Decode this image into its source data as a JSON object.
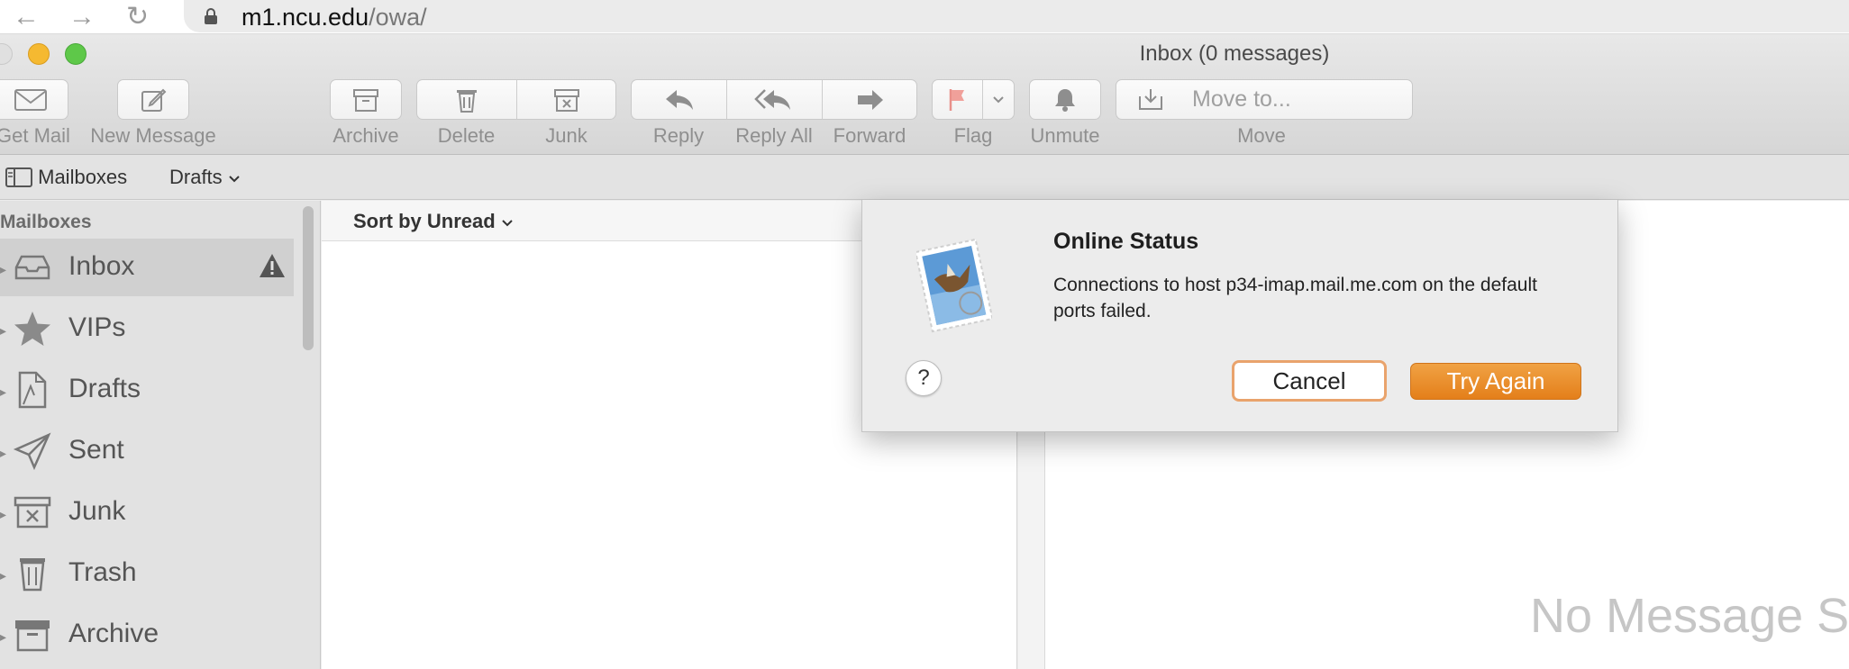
{
  "browser": {
    "url_host": "m1.ncu.edu",
    "url_path": "/owa/",
    "nav": [
      "back-icon",
      "forward-icon",
      "reload-icon"
    ]
  },
  "window": {
    "title": "Inbox (0 messages)",
    "traffic_colors": [
      "#e0e0e0",
      "#f5b931",
      "#5ec849"
    ]
  },
  "toolbar": {
    "get_mail": "Get Mail",
    "new_message": "New Message",
    "archive": "Archive",
    "delete": "Delete",
    "junk": "Junk",
    "reply": "Reply",
    "reply_all": "Reply All",
    "forward": "Forward",
    "flag": "Flag",
    "unmute": "Unmute",
    "move_placeholder": "Move to...",
    "move": "Move"
  },
  "favorites": {
    "mailboxes": "Mailboxes",
    "drafts": "Drafts"
  },
  "sidebar": {
    "header": "Mailboxes",
    "items": [
      {
        "label": "Inbox",
        "icon": "inbox-icon"
      },
      {
        "label": "VIPs",
        "icon": "star-icon"
      },
      {
        "label": "Drafts",
        "icon": "drafts-icon"
      },
      {
        "label": "Sent",
        "icon": "sent-icon"
      },
      {
        "label": "Junk",
        "icon": "junk-icon"
      },
      {
        "label": "Trash",
        "icon": "trash-icon"
      },
      {
        "label": "Archive",
        "icon": "archive-icon"
      }
    ]
  },
  "message_list": {
    "sort_label": "Sort by Unread"
  },
  "viewer": {
    "empty_text": "No Message S"
  },
  "dialog": {
    "title": "Online Status",
    "message": "Connections to host p34-imap.mail.me.com on the default ports failed.",
    "help": "?",
    "cancel": "Cancel",
    "try_again": "Try Again",
    "accent": "#e88a22"
  }
}
